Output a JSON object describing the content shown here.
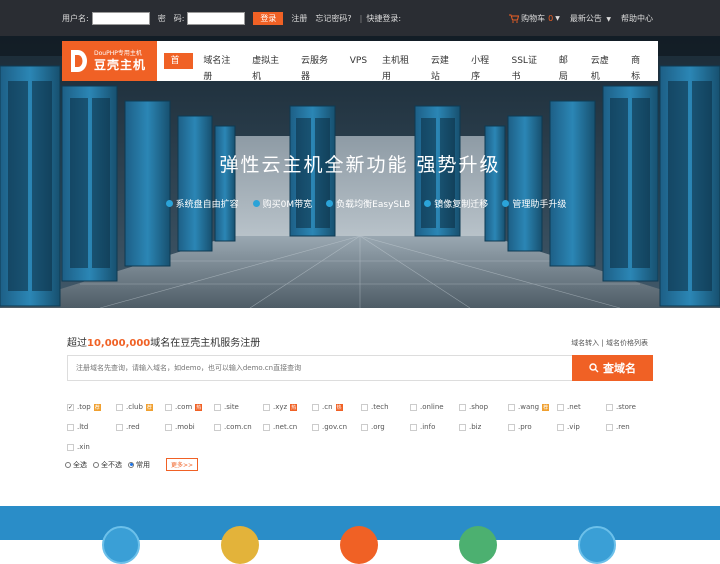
{
  "topbar": {
    "username_label": "用户名:",
    "password_label": "密　码:",
    "login_button": "登录",
    "register_link": "注册",
    "forgot_link": "忘记密码?",
    "separator": "|",
    "quick_login": "快捷登录:",
    "cart_label": "购物车",
    "cart_count": "0",
    "announcements": "最新公告",
    "help": "帮助中心"
  },
  "logo": {
    "subtitle": "DouPHP专用主机",
    "title": "豆壳主机"
  },
  "nav": {
    "items": [
      "首页",
      "域名注册",
      "虚拟主机",
      "云服务器",
      "VPS",
      "主机租用",
      "云建站",
      "小程序",
      "SSL证书",
      "邮局",
      "云虚机",
      "商标"
    ]
  },
  "hero": {
    "title": "弹性云主机全新功能  强势升级",
    "features": [
      "系统盘自由扩容",
      "购买0M带宽",
      "负载均衡EasySLB",
      "镜像复制迁移",
      "管理助手升级"
    ]
  },
  "domain": {
    "heading_prefix": "超过",
    "heading_number": "10,000,000",
    "heading_suffix": "域名在豆壳主机服务注册",
    "links": "域名转入 | 域名价格列表",
    "search_placeholder": "注册域名先查询，请输入域名，如demo，也可以输入demo.cn直接查询",
    "search_button": "查域名",
    "tlds": [
      {
        "name": ".top",
        "checked": true,
        "badge": "荐"
      },
      {
        "name": ".club",
        "checked": false,
        "badge": "荐"
      },
      {
        "name": ".com",
        "checked": false,
        "badge": "热"
      },
      {
        "name": ".site",
        "checked": false,
        "badge": ""
      },
      {
        "name": ".xyz",
        "checked": false,
        "badge": "热"
      },
      {
        "name": ".cn",
        "checked": false,
        "badge": "热"
      },
      {
        "name": ".tech",
        "checked": false,
        "badge": ""
      },
      {
        "name": ".online",
        "checked": false,
        "badge": ""
      },
      {
        "name": ".shop",
        "checked": false,
        "badge": ""
      },
      {
        "name": ".wang",
        "checked": false,
        "badge": "荐"
      },
      {
        "name": ".net",
        "checked": false,
        "badge": ""
      },
      {
        "name": ".store",
        "checked": false,
        "badge": ""
      },
      {
        "name": ".ltd",
        "checked": false,
        "badge": ""
      },
      {
        "name": ".red",
        "checked": false,
        "badge": ""
      },
      {
        "name": ".mobi",
        "checked": false,
        "badge": ""
      },
      {
        "name": ".com.cn",
        "checked": false,
        "badge": ""
      },
      {
        "name": ".net.cn",
        "checked": false,
        "badge": ""
      },
      {
        "name": ".gov.cn",
        "checked": false,
        "badge": ""
      },
      {
        "name": ".org",
        "checked": false,
        "badge": ""
      },
      {
        "name": ".info",
        "checked": false,
        "badge": ""
      },
      {
        "name": ".biz",
        "checked": false,
        "badge": ""
      },
      {
        "name": ".pro",
        "checked": false,
        "badge": ""
      },
      {
        "name": ".vip",
        "checked": false,
        "badge": ""
      },
      {
        "name": ".ren",
        "checked": false,
        "badge": ""
      },
      {
        "name": ".xin",
        "checked": false,
        "badge": ""
      }
    ],
    "radio_all": "全选",
    "radio_none": "全不选",
    "radio_common": "常用",
    "selected_radio": "常用",
    "more_button": "更多>>"
  },
  "colors": {
    "accent": "#f06125",
    "topbar": "#2a2d33",
    "band": "#2a8dc8"
  }
}
